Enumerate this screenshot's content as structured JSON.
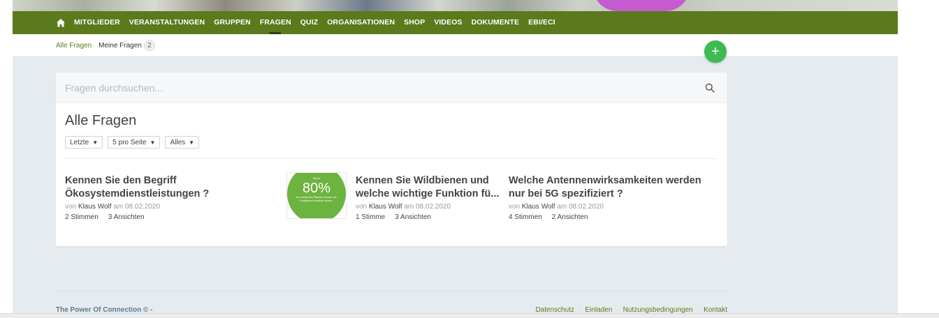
{
  "nav": {
    "home_icon": "home-icon",
    "items": [
      {
        "label": "MITGLIEDER",
        "active": false
      },
      {
        "label": "VERANSTALTUNGEN",
        "active": false
      },
      {
        "label": "GRUPPEN",
        "active": false
      },
      {
        "label": "FRAGEN",
        "active": true
      },
      {
        "label": "QUIZ",
        "active": false
      },
      {
        "label": "ORGANISATIONEN",
        "active": false
      },
      {
        "label": "SHOP",
        "active": false
      },
      {
        "label": "VIDEOS",
        "active": false
      },
      {
        "label": "DOKUMENTE",
        "active": false
      },
      {
        "label": "EBI/ECI",
        "active": false
      }
    ]
  },
  "subnav": {
    "all_label": "Alle Fragen",
    "mine_label": "Meine Fragen",
    "mine_count": "2"
  },
  "fab": {
    "label": "+",
    "icon": "plus-icon"
  },
  "search": {
    "placeholder": "Fragen durchsuchen..."
  },
  "main": {
    "title": "Alle Fragen",
    "filters": [
      "Letzte",
      "5 pro Seite",
      "Alles"
    ]
  },
  "questions": [
    {
      "title": "Kennen Sie den Begriff Ökosystemdienstleistungen ?",
      "by": "von",
      "author": "Klaus Wolf",
      "on": "am",
      "date": "08.02.2020",
      "votes": "2 Stimmen",
      "views": "3 Ansichten"
    },
    {
      "title": "Kennen Sie Wildbienen und welche wichtige Funktion fü...",
      "by": "von",
      "author": "Klaus Wolf",
      "on": "am",
      "date": "08.02.2020",
      "votes": "1 Stimme",
      "views": "3 Ansichten",
      "thumb": {
        "small": "Rund",
        "big": "80%",
        "desc": "der heimischen Pflanzen müssen von Honigbienen bestäubt werden."
      }
    },
    {
      "title": "Welche Antennenwirksamkeiten werden nur bei 5G spezifiziert ?",
      "by": "von",
      "author": "Klaus Wolf",
      "on": "am",
      "date": "08.02.2020",
      "votes": "4 Stimmen",
      "views": "2 Ansichten"
    }
  ],
  "footer": {
    "copyright": "The Power Of Connection © -",
    "links": [
      "Datenschutz",
      "Einladen",
      "Nutzungsbedingungen",
      "Kontakt"
    ]
  },
  "colors": {
    "nav_green": "#5a7a1c",
    "fab_green": "#3dba54",
    "link_green": "#5a7a1c",
    "page_bg": "#e6ebef"
  }
}
